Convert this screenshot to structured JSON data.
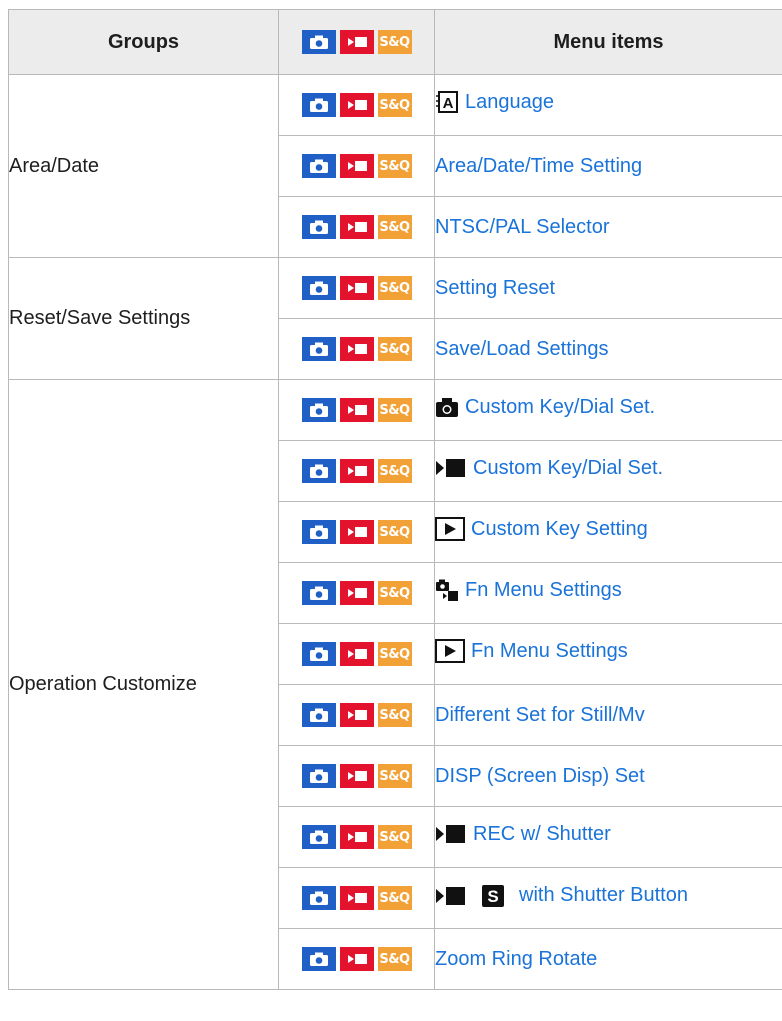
{
  "header": {
    "groups": "Groups",
    "menu_items": "Menu items",
    "mode_labels": [
      "still-camera-icon",
      "movie-camera-icon",
      "S&Q"
    ]
  },
  "colors": {
    "still": "#1f5fc6",
    "movie": "#e3132e",
    "sq": "#f2a136",
    "link": "#1a73d9"
  },
  "sq_label": "S&Q",
  "groups": [
    {
      "name": "Area/Date",
      "items": [
        {
          "icons": [
            "language-icon"
          ],
          "label": "Language"
        },
        {
          "icons": [],
          "label": "Area/Date/Time Setting"
        },
        {
          "icons": [],
          "label": "NTSC/PAL Selector"
        }
      ]
    },
    {
      "name": "Reset/Save Settings",
      "items": [
        {
          "icons": [],
          "label": "Setting Reset"
        },
        {
          "icons": [],
          "label": "Save/Load Settings"
        }
      ]
    },
    {
      "name": "Operation Customize",
      "items": [
        {
          "icons": [
            "still-camera-icon"
          ],
          "label": "Custom Key/Dial Set."
        },
        {
          "icons": [
            "movie-camera-icon"
          ],
          "label": "Custom Key/Dial Set."
        },
        {
          "icons": [
            "playback-icon"
          ],
          "label": "Custom Key Setting"
        },
        {
          "icons": [
            "still-movie-icon"
          ],
          "label": "Fn Menu Settings"
        },
        {
          "icons": [
            "playback-icon"
          ],
          "label": "Fn Menu Settings"
        },
        {
          "icons": [],
          "label": "Different Set for Still/Mv"
        },
        {
          "icons": [],
          "label": "DISP (Screen Disp) Set"
        },
        {
          "icons": [
            "movie-camera-icon"
          ],
          "label": "REC w/ Shutter"
        },
        {
          "icons": [
            "movie-camera-icon",
            "s-mode-icon"
          ],
          "label": "with Shutter Button"
        },
        {
          "icons": [],
          "label": "Zoom Ring Rotate"
        }
      ]
    }
  ]
}
